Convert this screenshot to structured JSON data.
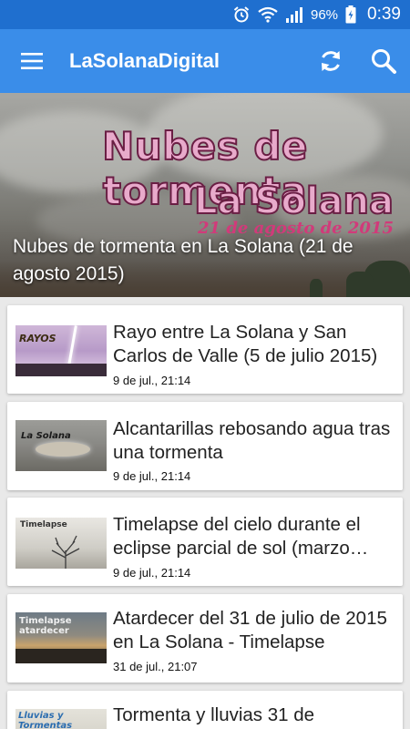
{
  "status_bar": {
    "battery": "96%",
    "time": "0:39"
  },
  "app_bar": {
    "title": "LaSolanaDigital",
    "icons": [
      "menu-icon",
      "refresh-icon",
      "search-icon"
    ]
  },
  "hero": {
    "image_title_line1": "Nubes de tormenta",
    "image_title_line2": "La Solana",
    "image_date": "21 de agosto de 2015",
    "caption": "Nubes de tormenta en La Solana (21 de agosto 2015)"
  },
  "articles": [
    {
      "title": "Rayo entre La Solana y San Carlos de Valle (5 de julio 2015)",
      "date": "9 de jul., 21:14",
      "thumb_label": "RAYOS"
    },
    {
      "title": "Alcantarillas rebosando agua tras una tormenta",
      "date": "9 de jul., 21:14",
      "thumb_label": "La Solana"
    },
    {
      "title": "Timelapse del cielo durante el eclipse parcial de sol (marzo…",
      "date": "9 de jul., 21:14",
      "thumb_label": "Timelapse"
    },
    {
      "title": "Atardecer del 31 de julio de 2015 en La Solana - Timelapse",
      "date": "31 de jul., 21:07",
      "thumb_label": "Timelapse atardecer"
    },
    {
      "title": "Tormenta y lluvias 31 de",
      "date": "",
      "thumb_label": "Lluvias y Tormentas"
    }
  ],
  "colors": {
    "status_bar": "#1f6fcf",
    "app_bar": "#3a8de9",
    "background": "#e9e9e9"
  }
}
